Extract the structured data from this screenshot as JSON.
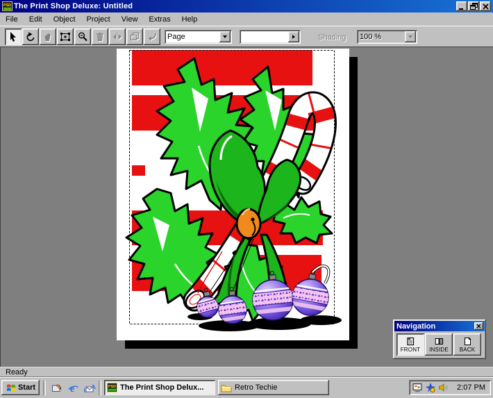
{
  "window": {
    "title": "The Print Shop Deluxe: Untitled",
    "app_icon_text": "PSD",
    "controls": {
      "minimize": "minimize",
      "restore": "restore",
      "close": "close"
    }
  },
  "menu_bar": {
    "items": [
      "File",
      "Edit",
      "Object",
      "Project",
      "View",
      "Extras",
      "Help"
    ]
  },
  "toolbar": {
    "buttons": [
      {
        "icon": "pointer-icon",
        "state": "selected"
      },
      {
        "icon": "rotate-icon",
        "state": "enabled"
      },
      {
        "icon": "hand-icon",
        "state": "disabled"
      },
      {
        "icon": "zoom-frame-icon",
        "state": "enabled"
      },
      {
        "icon": "magnifier-icon",
        "state": "enabled"
      },
      {
        "icon": "trash-icon",
        "state": "disabled"
      },
      {
        "icon": "flip-icon",
        "state": "disabled"
      },
      {
        "icon": "layers-icon",
        "state": "disabled"
      },
      {
        "icon": "undo-icon",
        "state": "disabled"
      }
    ],
    "page_select": {
      "value": "Page"
    },
    "item_select": {
      "value": ""
    },
    "shading_label": "Shading",
    "shading_value": "100 %"
  },
  "artwork": {
    "description": "Holiday card front: holly leaves, candy cane, green bow with orange bell, purple ornaments on red striped background",
    "colors": {
      "stripe_red": "#e81111",
      "holly_green": "#2bd42b",
      "bow_green": "#1cb51c",
      "bow_shade": "#0a6a0a",
      "bell_orange": "#f08a1e",
      "cane_red": "#e81111",
      "ornament_purple": "#6a4bd8",
      "ornament_band_pink": "#f2c4ee",
      "ornament_pattern": "#5b1fd0"
    }
  },
  "navigation": {
    "title": "Navigation",
    "buttons": [
      {
        "label": "FRONT",
        "state": "selected"
      },
      {
        "label": "INSIDE",
        "state": "normal"
      },
      {
        "label": "BACK",
        "state": "normal"
      }
    ]
  },
  "status_bar": {
    "text": "Ready"
  },
  "taskbar": {
    "start_label": "Start",
    "quick_launch": [
      "show-desktop-icon",
      "internet-explorer-icon",
      "outlook-express-icon"
    ],
    "ie_letter": "e",
    "tasks": [
      {
        "label": "The Print Shop Delux...",
        "active": true
      },
      {
        "label": "Retro Techie",
        "active": false
      }
    ],
    "tray": {
      "icons": [
        "display-icon",
        "scheduler-icon",
        "volume-icon"
      ],
      "clock": "2:07 PM"
    }
  }
}
